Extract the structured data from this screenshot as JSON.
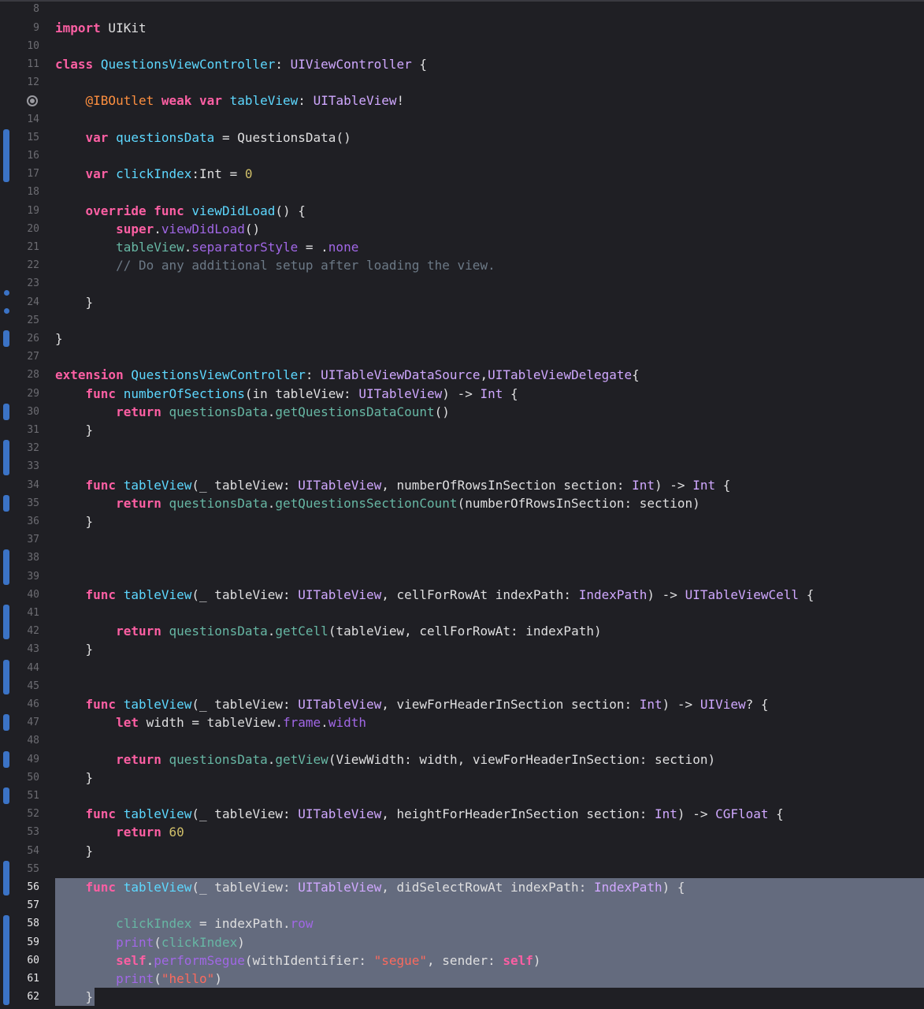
{
  "editor": {
    "selection_start_line": 56,
    "selection_end_line": 62,
    "change_bars": [
      [
        15,
        17
      ],
      [
        26,
        26
      ],
      [
        30,
        30
      ],
      [
        32,
        33
      ],
      [
        35,
        35
      ],
      [
        38,
        39
      ],
      [
        41,
        42
      ],
      [
        44,
        45
      ],
      [
        47,
        47
      ],
      [
        49,
        49
      ],
      [
        51,
        51
      ],
      [
        55,
        56
      ],
      [
        58,
        62
      ]
    ],
    "change_dots": [
      23.5,
      24.5
    ],
    "breakpoint_line": 13,
    "lines": [
      {
        "n": "8",
        "t": []
      },
      {
        "n": "9",
        "t": [
          [
            "kw",
            "import"
          ],
          [
            "pl",
            " UIKit"
          ]
        ]
      },
      {
        "n": "10",
        "t": []
      },
      {
        "n": "11",
        "t": [
          [
            "kw",
            "class"
          ],
          [
            "pl",
            " "
          ],
          [
            "decl",
            "QuestionsViewController"
          ],
          [
            "pl",
            ": "
          ],
          [
            "type",
            "UIViewController"
          ],
          [
            "pl",
            " {"
          ]
        ]
      },
      {
        "n": "12",
        "t": []
      },
      {
        "n": "",
        "t": [
          [
            "pl",
            "    "
          ],
          [
            "attr",
            "@IBOutlet"
          ],
          [
            "pl",
            " "
          ],
          [
            "kw",
            "weak"
          ],
          [
            "pl",
            " "
          ],
          [
            "kw",
            "var"
          ],
          [
            "pl",
            " "
          ],
          [
            "decl",
            "tableView"
          ],
          [
            "pl",
            ": "
          ],
          [
            "type",
            "UITableView"
          ],
          [
            "pl",
            "!"
          ]
        ]
      },
      {
        "n": "14",
        "t": []
      },
      {
        "n": "15",
        "t": [
          [
            "pl",
            "    "
          ],
          [
            "kw",
            "var"
          ],
          [
            "pl",
            " "
          ],
          [
            "decl",
            "questionsData"
          ],
          [
            "pl",
            " = QuestionsData()"
          ]
        ]
      },
      {
        "n": "16",
        "t": []
      },
      {
        "n": "17",
        "t": [
          [
            "pl",
            "    "
          ],
          [
            "kw",
            "var"
          ],
          [
            "pl",
            " "
          ],
          [
            "decl",
            "clickIndex"
          ],
          [
            "pl",
            ":Int = "
          ],
          [
            "num",
            "0"
          ]
        ]
      },
      {
        "n": "18",
        "t": []
      },
      {
        "n": "19",
        "t": [
          [
            "pl",
            "    "
          ],
          [
            "kw",
            "override"
          ],
          [
            "pl",
            " "
          ],
          [
            "kw",
            "func"
          ],
          [
            "pl",
            " "
          ],
          [
            "decl",
            "viewDidLoad"
          ],
          [
            "pl",
            "() {"
          ]
        ]
      },
      {
        "n": "20",
        "t": [
          [
            "pl",
            "        "
          ],
          [
            "kw",
            "super"
          ],
          [
            "pl",
            "."
          ],
          [
            "proj",
            "viewDidLoad"
          ],
          [
            "pl",
            "()"
          ]
        ]
      },
      {
        "n": "21",
        "t": [
          [
            "pl",
            "        "
          ],
          [
            "prop",
            "tableView"
          ],
          [
            "pl",
            "."
          ],
          [
            "proj",
            "separatorStyle"
          ],
          [
            "pl",
            " = ."
          ],
          [
            "proj",
            "none"
          ]
        ]
      },
      {
        "n": "22",
        "t": [
          [
            "pl",
            "        "
          ],
          [
            "cmt",
            "// Do any additional setup after loading the view."
          ]
        ]
      },
      {
        "n": "23",
        "t": []
      },
      {
        "n": "24",
        "t": [
          [
            "pl",
            "    }"
          ]
        ]
      },
      {
        "n": "25",
        "t": []
      },
      {
        "n": "26",
        "t": [
          [
            "pl",
            "}"
          ]
        ]
      },
      {
        "n": "27",
        "t": []
      },
      {
        "n": "28",
        "t": [
          [
            "kw",
            "extension"
          ],
          [
            "pl",
            " "
          ],
          [
            "decl",
            "QuestionsViewController"
          ],
          [
            "pl",
            ": "
          ],
          [
            "type",
            "UITableViewDataSource"
          ],
          [
            "pl",
            ","
          ],
          [
            "type",
            "UITableViewDelegate"
          ],
          [
            "pl",
            "{"
          ]
        ]
      },
      {
        "n": "29",
        "t": [
          [
            "pl",
            "    "
          ],
          [
            "kw",
            "func"
          ],
          [
            "pl",
            " "
          ],
          [
            "decl",
            "numberOfSections"
          ],
          [
            "pl",
            "(in tableView: "
          ],
          [
            "type",
            "UITableView"
          ],
          [
            "pl",
            ") -> "
          ],
          [
            "type",
            "Int"
          ],
          [
            "pl",
            " {"
          ]
        ]
      },
      {
        "n": "30",
        "t": [
          [
            "pl",
            "        "
          ],
          [
            "kw",
            "return"
          ],
          [
            "pl",
            " "
          ],
          [
            "prop",
            "questionsData"
          ],
          [
            "pl",
            "."
          ],
          [
            "prop",
            "getQuestionsDataCount"
          ],
          [
            "pl",
            "()"
          ]
        ]
      },
      {
        "n": "31",
        "t": [
          [
            "pl",
            "    }"
          ]
        ]
      },
      {
        "n": "32",
        "t": []
      },
      {
        "n": "33",
        "t": []
      },
      {
        "n": "34",
        "t": [
          [
            "pl",
            "    "
          ],
          [
            "kw",
            "func"
          ],
          [
            "pl",
            " "
          ],
          [
            "decl",
            "tableView"
          ],
          [
            "pl",
            "(_ tableView: "
          ],
          [
            "type",
            "UITableView"
          ],
          [
            "pl",
            ", numberOfRowsInSection section: "
          ],
          [
            "type",
            "Int"
          ],
          [
            "pl",
            ") -> "
          ],
          [
            "type",
            "Int"
          ],
          [
            "pl",
            " {"
          ]
        ]
      },
      {
        "n": "35",
        "t": [
          [
            "pl",
            "        "
          ],
          [
            "kw",
            "return"
          ],
          [
            "pl",
            " "
          ],
          [
            "prop",
            "questionsData"
          ],
          [
            "pl",
            "."
          ],
          [
            "prop",
            "getQuestionsSectionCount"
          ],
          [
            "pl",
            "(numberOfRowsInSection: section)"
          ]
        ]
      },
      {
        "n": "36",
        "t": [
          [
            "pl",
            "    }"
          ]
        ]
      },
      {
        "n": "37",
        "t": []
      },
      {
        "n": "38",
        "t": []
      },
      {
        "n": "39",
        "t": []
      },
      {
        "n": "40",
        "t": [
          [
            "pl",
            "    "
          ],
          [
            "kw",
            "func"
          ],
          [
            "pl",
            " "
          ],
          [
            "decl",
            "tableView"
          ],
          [
            "pl",
            "(_ tableView: "
          ],
          [
            "type",
            "UITableView"
          ],
          [
            "pl",
            ", cellForRowAt indexPath: "
          ],
          [
            "type",
            "IndexPath"
          ],
          [
            "pl",
            ") -> "
          ],
          [
            "type",
            "UITableViewCell"
          ],
          [
            "pl",
            " {"
          ]
        ]
      },
      {
        "n": "41",
        "t": []
      },
      {
        "n": "42",
        "t": [
          [
            "pl",
            "        "
          ],
          [
            "kw",
            "return"
          ],
          [
            "pl",
            " "
          ],
          [
            "prop",
            "questionsData"
          ],
          [
            "pl",
            "."
          ],
          [
            "prop",
            "getCell"
          ],
          [
            "pl",
            "(tableView, cellForRowAt: indexPath)"
          ]
        ]
      },
      {
        "n": "43",
        "t": [
          [
            "pl",
            "    }"
          ]
        ]
      },
      {
        "n": "44",
        "t": []
      },
      {
        "n": "45",
        "t": []
      },
      {
        "n": "46",
        "t": [
          [
            "pl",
            "    "
          ],
          [
            "kw",
            "func"
          ],
          [
            "pl",
            " "
          ],
          [
            "decl",
            "tableView"
          ],
          [
            "pl",
            "(_ tableView: "
          ],
          [
            "type",
            "UITableView"
          ],
          [
            "pl",
            ", viewForHeaderInSection section: "
          ],
          [
            "type",
            "Int"
          ],
          [
            "pl",
            ") -> "
          ],
          [
            "type",
            "UIView"
          ],
          [
            "pl",
            "? {"
          ]
        ]
      },
      {
        "n": "47",
        "t": [
          [
            "pl",
            "        "
          ],
          [
            "kw",
            "let"
          ],
          [
            "pl",
            " width = tableView."
          ],
          [
            "proj",
            "frame"
          ],
          [
            "pl",
            "."
          ],
          [
            "proj",
            "width"
          ]
        ]
      },
      {
        "n": "48",
        "t": []
      },
      {
        "n": "49",
        "t": [
          [
            "pl",
            "        "
          ],
          [
            "kw",
            "return"
          ],
          [
            "pl",
            " "
          ],
          [
            "prop",
            "questionsData"
          ],
          [
            "pl",
            "."
          ],
          [
            "prop",
            "getView"
          ],
          [
            "pl",
            "(ViewWidth: width, viewForHeaderInSection: section)"
          ]
        ]
      },
      {
        "n": "50",
        "t": [
          [
            "pl",
            "    }"
          ]
        ]
      },
      {
        "n": "51",
        "t": []
      },
      {
        "n": "52",
        "t": [
          [
            "pl",
            "    "
          ],
          [
            "kw",
            "func"
          ],
          [
            "pl",
            " "
          ],
          [
            "decl",
            "tableView"
          ],
          [
            "pl",
            "(_ tableView: "
          ],
          [
            "type",
            "UITableView"
          ],
          [
            "pl",
            ", heightForHeaderInSection section: "
          ],
          [
            "type",
            "Int"
          ],
          [
            "pl",
            ") -> "
          ],
          [
            "type",
            "CGFloat"
          ],
          [
            "pl",
            " {"
          ]
        ]
      },
      {
        "n": "53",
        "t": [
          [
            "pl",
            "        "
          ],
          [
            "kw",
            "return"
          ],
          [
            "pl",
            " "
          ],
          [
            "num",
            "60"
          ]
        ]
      },
      {
        "n": "54",
        "t": [
          [
            "pl",
            "    }"
          ]
        ]
      },
      {
        "n": "55",
        "t": []
      },
      {
        "n": "56",
        "t": [
          [
            "pl",
            "    "
          ],
          [
            "kw",
            "func"
          ],
          [
            "pl",
            " "
          ],
          [
            "decl",
            "tableView"
          ],
          [
            "pl",
            "(_ tableView: "
          ],
          [
            "type",
            "UITableView"
          ],
          [
            "pl",
            ", didSelectRowAt indexPath: "
          ],
          [
            "type",
            "IndexPath"
          ],
          [
            "pl",
            ") {"
          ]
        ]
      },
      {
        "n": "57",
        "t": []
      },
      {
        "n": "58",
        "t": [
          [
            "pl",
            "        "
          ],
          [
            "prop",
            "clickIndex"
          ],
          [
            "pl",
            " = indexPath."
          ],
          [
            "proj",
            "row"
          ]
        ]
      },
      {
        "n": "59",
        "t": [
          [
            "pl",
            "        "
          ],
          [
            "proj",
            "print"
          ],
          [
            "pl",
            "("
          ],
          [
            "prop",
            "clickIndex"
          ],
          [
            "pl",
            ")"
          ]
        ]
      },
      {
        "n": "60",
        "t": [
          [
            "pl",
            "        "
          ],
          [
            "kw",
            "self"
          ],
          [
            "pl",
            "."
          ],
          [
            "proj",
            "performSegue"
          ],
          [
            "pl",
            "(withIdentifier: "
          ],
          [
            "str",
            "\"segue\""
          ],
          [
            "pl",
            ", sender: "
          ],
          [
            "kw",
            "self"
          ],
          [
            "pl",
            ")"
          ]
        ]
      },
      {
        "n": "61",
        "t": [
          [
            "pl",
            "        "
          ],
          [
            "proj",
            "print"
          ],
          [
            "pl",
            "("
          ],
          [
            "str",
            "\"hello\""
          ],
          [
            "pl",
            ")"
          ]
        ]
      },
      {
        "n": "62",
        "t": [
          [
            "pl",
            "    }"
          ]
        ]
      }
    ]
  }
}
